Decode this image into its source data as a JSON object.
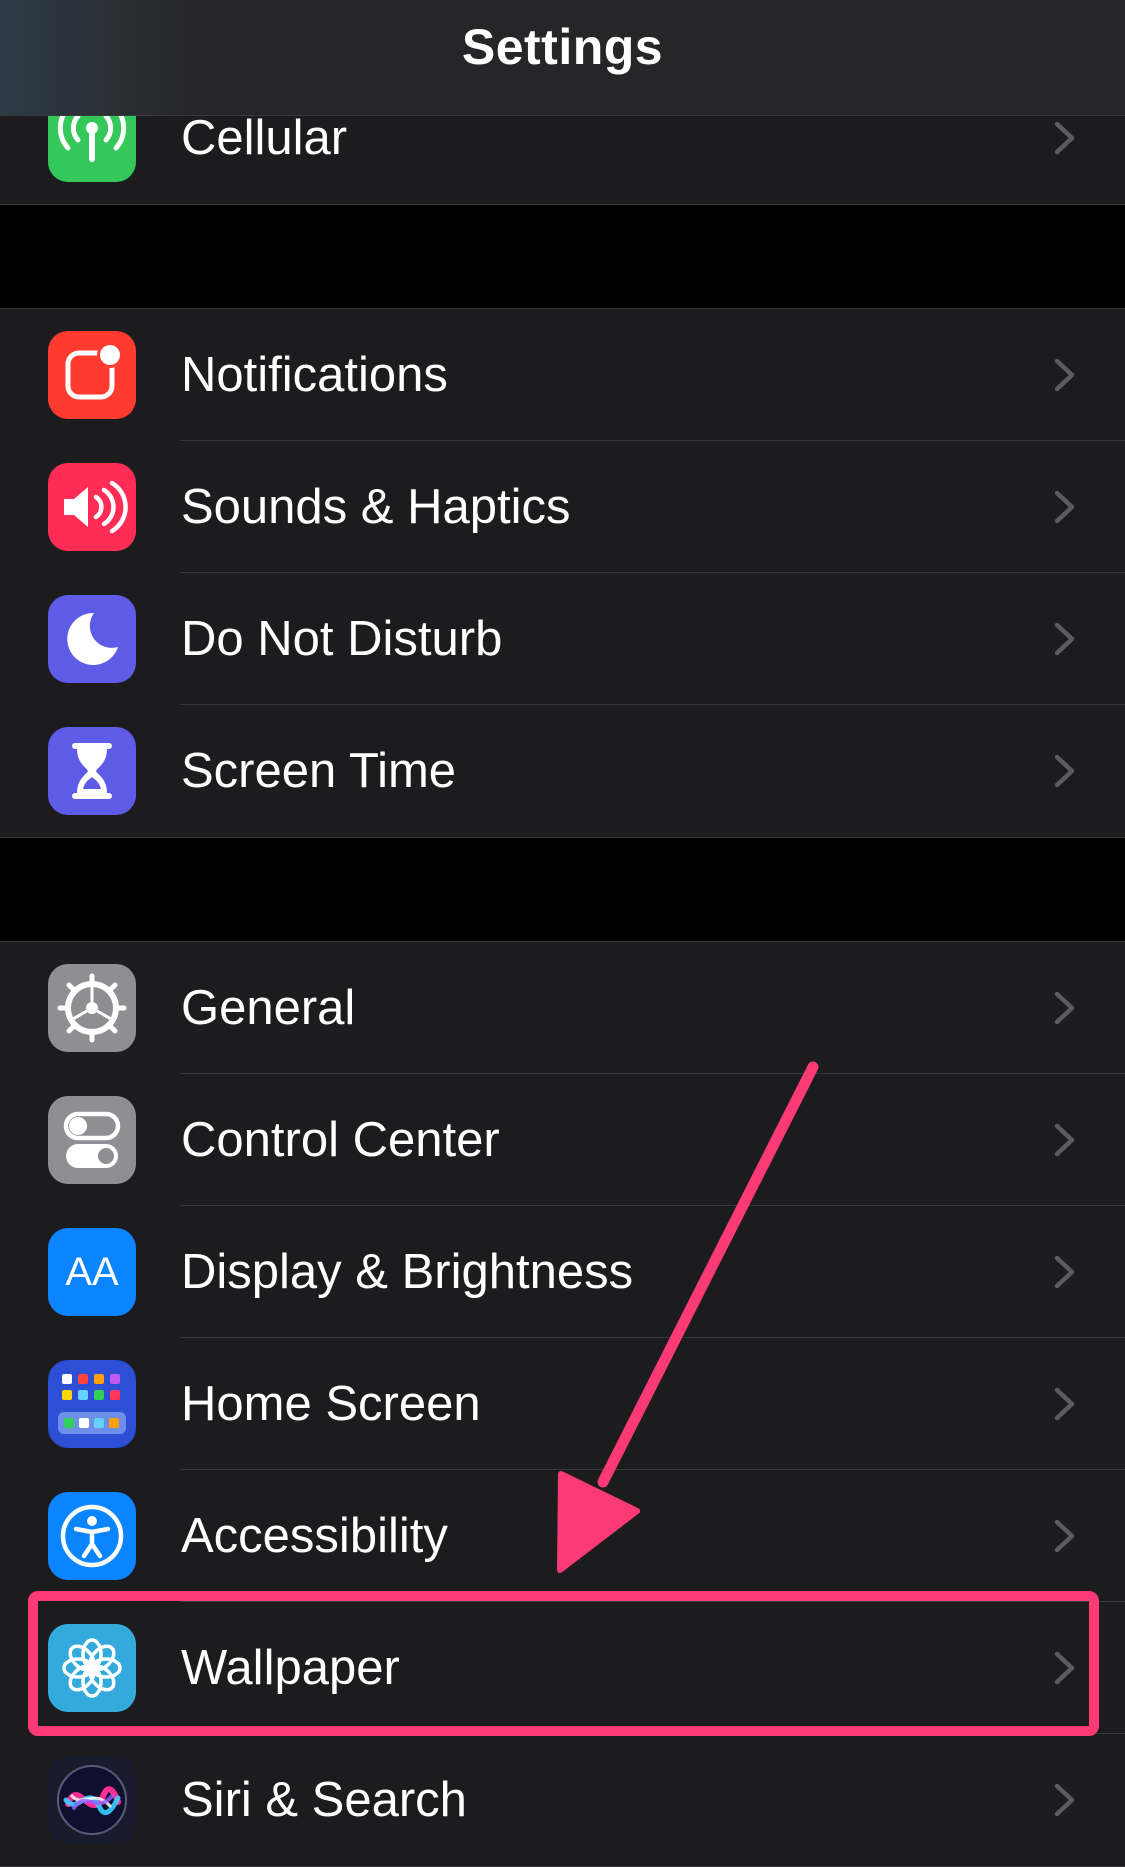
{
  "header": {
    "title": "Settings"
  },
  "colors": {
    "background": "#000000",
    "group_background": "#1c1c1e",
    "annotation": "#fb3a76",
    "chevron": "#5b5b60"
  },
  "groups": [
    {
      "items": [
        {
          "label": "Cellular",
          "icon": "cellular-antenna-icon",
          "icon_color": "#34c759"
        }
      ]
    },
    {
      "items": [
        {
          "label": "Notifications",
          "icon": "notifications-icon",
          "icon_color": "#ff3b30"
        },
        {
          "label": "Sounds & Haptics",
          "icon": "speaker-icon",
          "icon_color": "#ff2d55"
        },
        {
          "label": "Do Not Disturb",
          "icon": "moon-icon",
          "icon_color": "#5e5ce6"
        },
        {
          "label": "Screen Time",
          "icon": "hourglass-icon",
          "icon_color": "#5e5ce6"
        }
      ]
    },
    {
      "items": [
        {
          "label": "General",
          "icon": "gear-icon",
          "icon_color": "#8e8e93"
        },
        {
          "label": "Control Center",
          "icon": "toggles-icon",
          "icon_color": "#8e8e93"
        },
        {
          "label": "Display & Brightness",
          "icon": "text-size-icon",
          "icon_color": "#0a84ff"
        },
        {
          "label": "Home Screen",
          "icon": "app-grid-icon",
          "icon_color": "#2c4fd6"
        },
        {
          "label": "Accessibility",
          "icon": "accessibility-icon",
          "icon_color": "#0a84ff"
        },
        {
          "label": "Wallpaper",
          "icon": "flower-icon",
          "icon_color": "#34aadc"
        },
        {
          "label": "Siri & Search",
          "icon": "siri-icon",
          "icon_color": "#1b1b2e"
        }
      ]
    }
  ],
  "display_icon_text": "AA"
}
